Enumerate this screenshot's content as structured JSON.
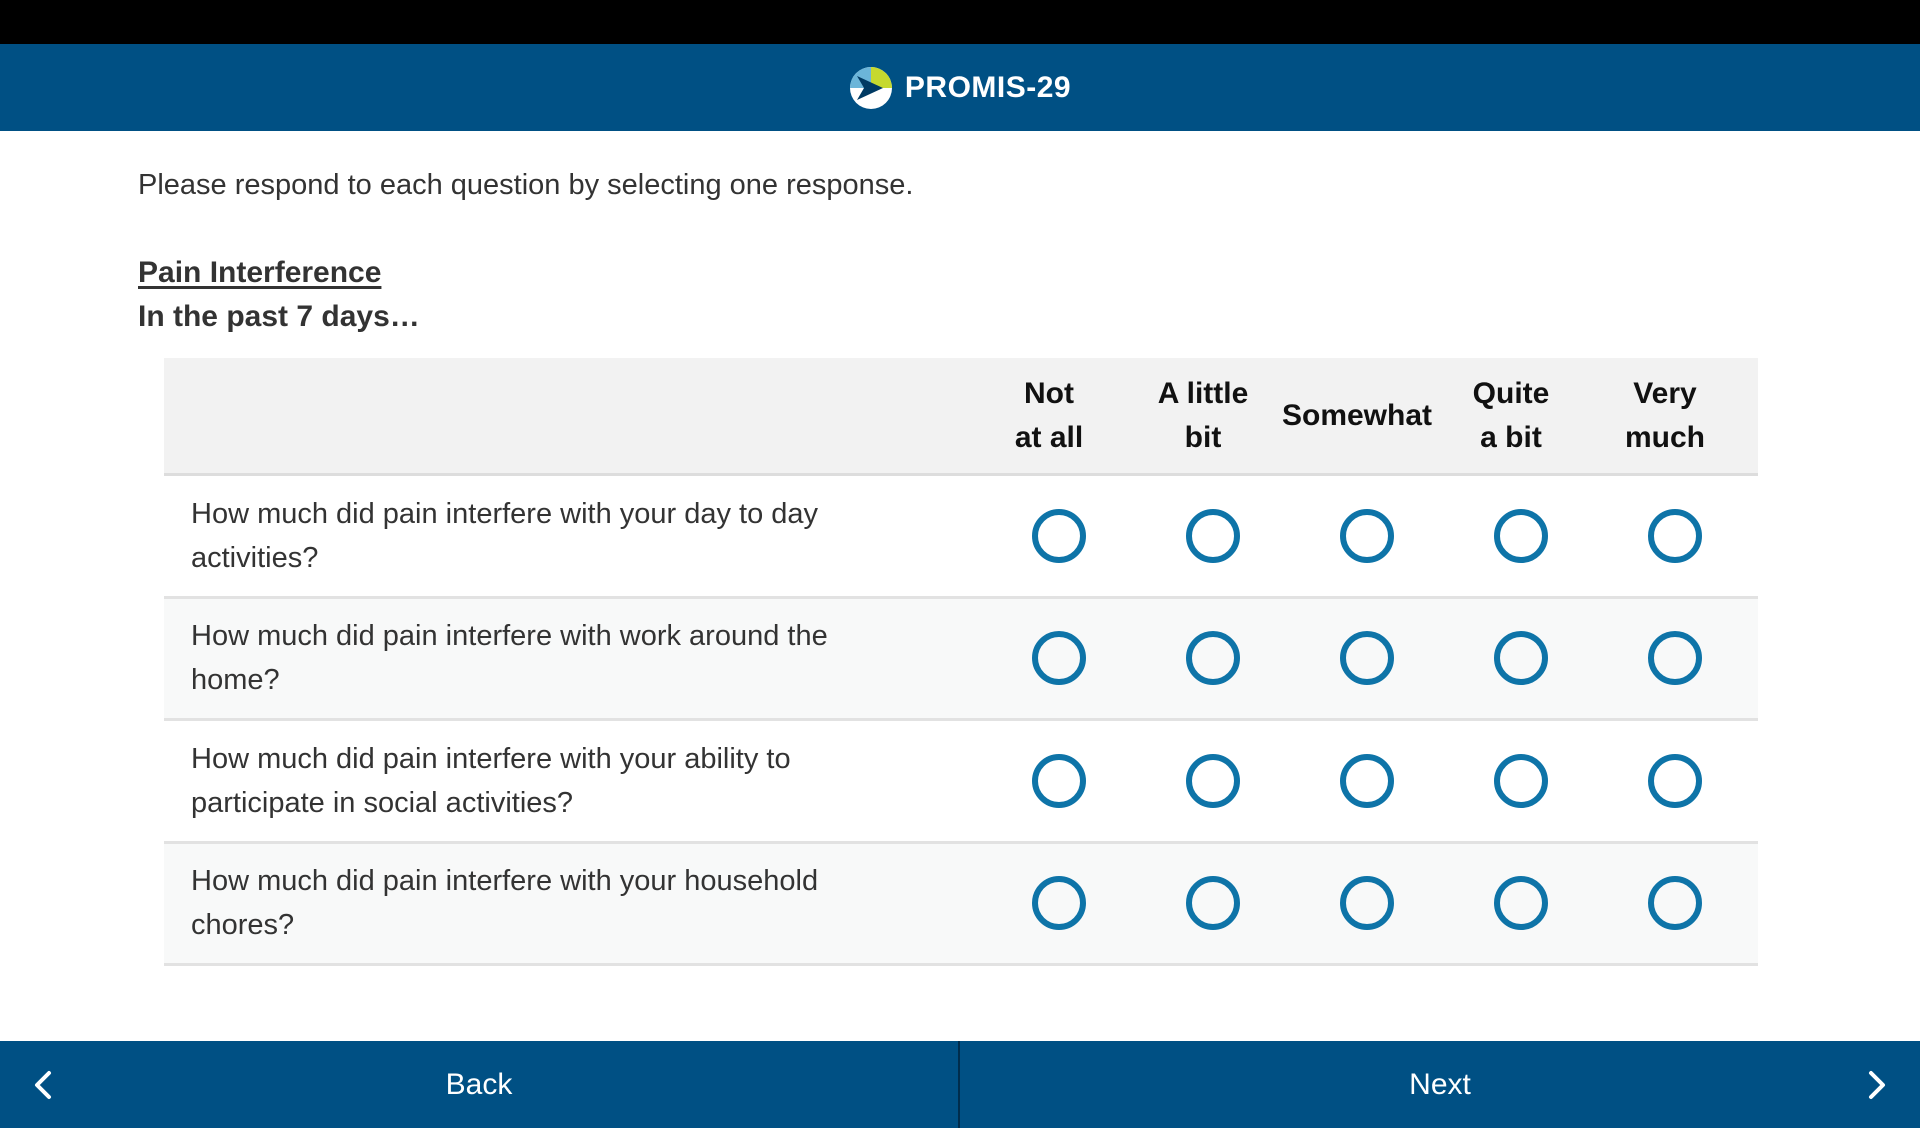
{
  "header": {
    "title": "PROMIS-29",
    "logo_icon": "promis-logo-icon",
    "background_color": "#005084"
  },
  "instructions": "Please respond to each question by selecting one response.",
  "section": {
    "title": "Pain Interference",
    "timeframe": "In the past 7 days…"
  },
  "response_options": [
    {
      "label": "Not\nat all"
    },
    {
      "label": "A little\nbit"
    },
    {
      "label": "Somewhat"
    },
    {
      "label": "Quite\na bit"
    },
    {
      "label": "Very\nmuch"
    }
  ],
  "questions": [
    {
      "text": "How much did pain interfere with your day to day activities?",
      "selected": null
    },
    {
      "text": "How much did pain interfere with work around the home?",
      "selected": null
    },
    {
      "text": "How much did pain interfere with your ability to participate in social activities?",
      "selected": null
    },
    {
      "text": "How much did pain interfere with your household chores?",
      "selected": null
    }
  ],
  "footer": {
    "back_label": "Back",
    "next_label": "Next",
    "back_icon": "chevron-left-icon",
    "next_icon": "chevron-right-icon"
  },
  "colors": {
    "accent": "#0e74a8",
    "bar": "#005084"
  }
}
